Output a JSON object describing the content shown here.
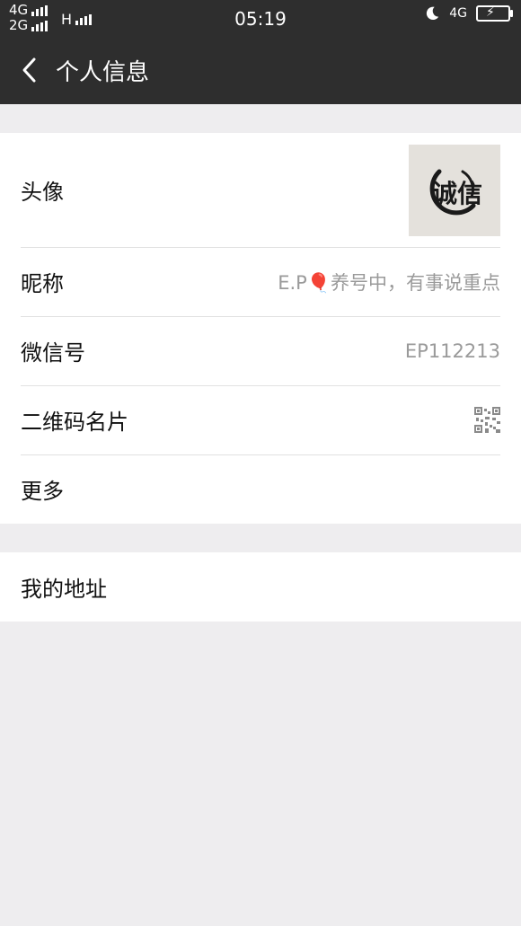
{
  "status_bar": {
    "sim1_network": "4G",
    "sim2_network": "2G",
    "data_network": "H",
    "time": "05:19",
    "wifi_network": "4G",
    "icons": [
      "signal-bars-icon",
      "moon-icon",
      "battery-charging-icon"
    ]
  },
  "nav": {
    "title": "个人信息",
    "back_icon": "chevron-left-icon"
  },
  "profile": {
    "avatar_label": "头像",
    "avatar_text": "诚信",
    "nickname_label": "昵称",
    "nickname_value": "E.P🎈养号中，有事说重点",
    "wechat_id_label": "微信号",
    "wechat_id_value": "EP112213",
    "qr_label": "二维码名片",
    "qr_icon": "qr-code-icon",
    "more_label": "更多"
  },
  "address": {
    "label": "我的地址"
  },
  "colors": {
    "header_bg": "#2E2E2E",
    "page_bg": "#EEEDEF",
    "value_gray": "#9A9A9A"
  }
}
